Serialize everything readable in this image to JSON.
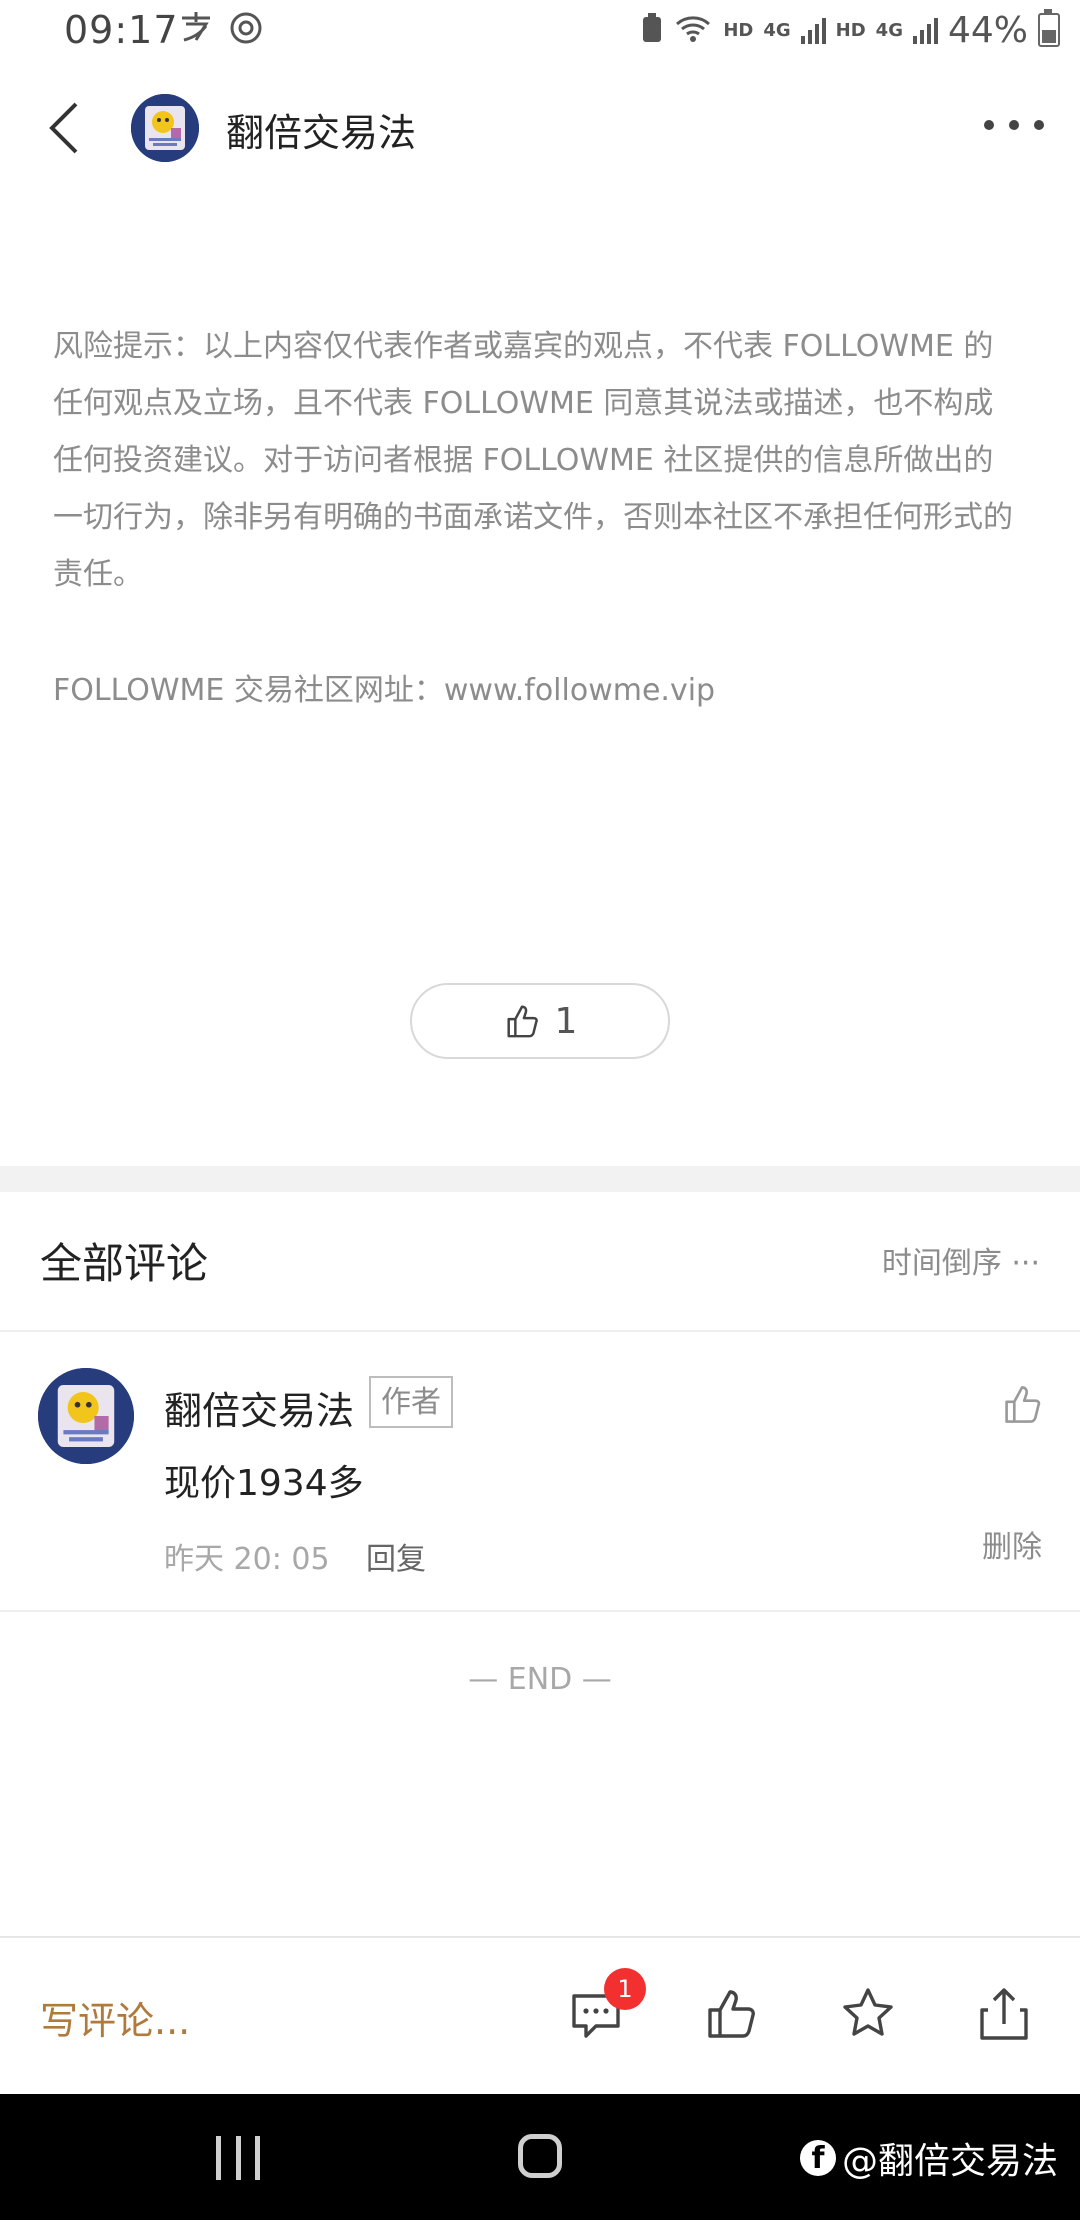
{
  "status_bar": {
    "time": "09:17",
    "hd1": "HD",
    "net1": "4G",
    "hd2": "HD",
    "net2": "4G",
    "battery": "44%",
    "battery_level": 0.44
  },
  "header": {
    "title": "翻倍交易法"
  },
  "article": {
    "disclaimer": "风险提示：以上内容仅代表作者或嘉宾的观点，不代表 FOLLOWME 的任何观点及立场，且不代表 FOLLOWME 同意其说法或描述，也不构成任何投资建议。对于访问者根据 FOLLOWME 社区提供的信息所做出的一切行为，除非另有明确的书面承诺文件，否则本社区不承担任何形式的责任。",
    "site": "FOLLOWME 交易社区网址：www.followme.vip",
    "like_count": "1"
  },
  "comments": {
    "title": "全部评论",
    "sort": "时间倒序 ···",
    "items": [
      {
        "author": "翻倍交易法",
        "badge": "作者",
        "text": "现价1934多",
        "time": "昨天 20: 05",
        "reply": "回复",
        "delete": "删除"
      }
    ],
    "end": "— END —"
  },
  "bottom_bar": {
    "write_placeholder": "写评论...",
    "comment_badge": "1"
  },
  "watermark": {
    "logo": "f",
    "text": "@翻倍交易法"
  },
  "colors": {
    "accent": "#b07a3c",
    "badge_red": "#f23030",
    "muted": "#8c8c8c"
  }
}
